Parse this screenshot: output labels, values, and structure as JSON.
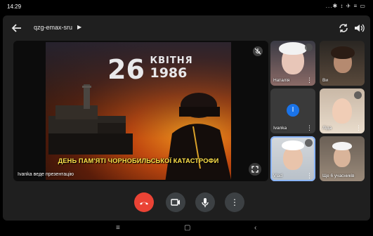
{
  "status": {
    "time": "14:29",
    "icons": "...✱ ↕ ✈ ≡ ▭"
  },
  "header": {
    "meeting_code": "qzg-emax-sru",
    "chevron": "▶"
  },
  "main": {
    "slide": {
      "day": "26",
      "month": "КВІТНЯ",
      "year": "1986",
      "caption": "ДЕНЬ ПАМ'ЯТІ ЧОРНОБИЛЬСЬКОЇ КАТАСТРОФИ"
    },
    "presenter_label": "Ivanka веде презентацію"
  },
  "participants": [
    {
      "name": "Наталія",
      "muted": true,
      "more": "⋮"
    },
    {
      "name": "Ви",
      "muted": false,
      "more": ""
    },
    {
      "name": "Ivanka",
      "initial": "I",
      "muted": false,
      "more": "⋮"
    },
    {
      "name": "Ліда",
      "muted": true,
      "more": "⋮"
    },
    {
      "name": "Vlad",
      "muted": true,
      "more": "⋮"
    },
    {
      "name": "Ще 6 учасників",
      "muted": false,
      "more": ""
    }
  ],
  "controls": {
    "more": "⋮"
  },
  "nav": {
    "recents": "≡",
    "home": "▢",
    "back": "‹"
  },
  "colors": {
    "app_bg": "#1f1f1f",
    "hangup": "#ea4335",
    "control_bg": "#3c4043",
    "avatar_blue": "#1a73e8",
    "caption_yellow": "#ffe14a"
  }
}
